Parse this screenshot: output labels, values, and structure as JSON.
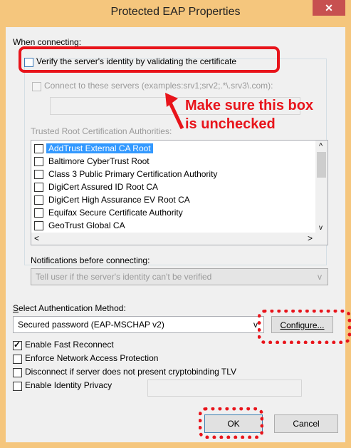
{
  "window": {
    "title": "Protected EAP Properties",
    "close_glyph": "✕"
  },
  "connecting": {
    "heading": "When connecting:",
    "verify_label": "Verify the server's identity by validating the certificate",
    "verify_checked": false,
    "connect_servers_label": "Connect to these servers (examples:srv1;srv2;.*\\.srv3\\.com):",
    "servers_value": ""
  },
  "trusted_ca": {
    "heading": "Trusted Root Certification Authorities:",
    "items": [
      {
        "label": "AddTrust External CA Root",
        "checked": false,
        "selected": true
      },
      {
        "label": "Baltimore CyberTrust Root",
        "checked": false,
        "selected": false
      },
      {
        "label": "Class 3 Public Primary Certification Authority",
        "checked": false,
        "selected": false
      },
      {
        "label": "DigiCert Assured ID Root CA",
        "checked": false,
        "selected": false
      },
      {
        "label": "DigiCert High Assurance EV Root CA",
        "checked": false,
        "selected": false
      },
      {
        "label": "Equifax Secure Certificate Authority",
        "checked": false,
        "selected": false
      },
      {
        "label": "GeoTrust Global CA",
        "checked": false,
        "selected": false
      }
    ],
    "scroll_up": "^",
    "scroll_down": "v",
    "scroll_left": "<",
    "scroll_right": ">"
  },
  "notifications": {
    "heading": "Notifications before connecting:",
    "value": "Tell user if the server's identity can't be verified",
    "arrow": "v"
  },
  "auth": {
    "heading": "Select Authentication Method:",
    "value": "Secured password (EAP-MSCHAP v2)",
    "arrow": "v",
    "configure_label": "Configure..."
  },
  "options": [
    {
      "label": "Enable Fast Reconnect",
      "checked": true
    },
    {
      "label": "Enforce Network Access Protection",
      "checked": false
    },
    {
      "label": "Disconnect if server does not present cryptobinding TLV",
      "checked": false
    },
    {
      "label": "Enable Identity Privacy",
      "checked": false
    }
  ],
  "identity_value": "",
  "buttons": {
    "ok_label": "OK",
    "cancel_label": "Cancel"
  },
  "annotation": {
    "line1": "Make sure this box",
    "line2": "is unchecked"
  },
  "colors": {
    "annotation": "#e8141b",
    "selection": "#3399ff",
    "frame": "#f5c67d"
  }
}
